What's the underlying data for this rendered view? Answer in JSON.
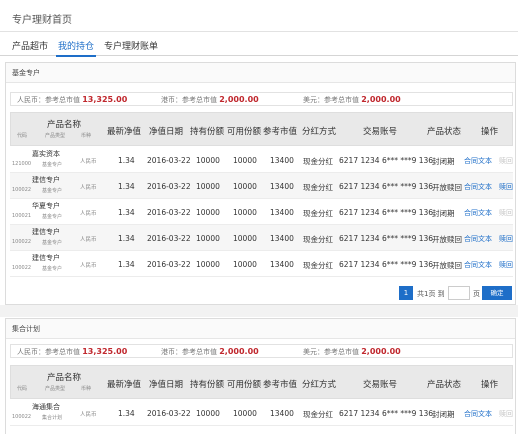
{
  "page": {
    "title": "专户理财首页"
  },
  "tabs": [
    {
      "label": "产品超市"
    },
    {
      "label": "我的持仓"
    },
    {
      "label": "专户理财账单"
    }
  ],
  "summary": {
    "rmb_label": "人民币：参考总市值",
    "hkd_label": "港币：参考总市值",
    "usd_label": "美元：参考总市值"
  },
  "table_header": {
    "product": "产品名称",
    "code": "代码",
    "type": "产品类型",
    "currency": "币种",
    "nav": "最新净值",
    "nav_date": "净值日期",
    "holding": "持有份额",
    "available": "可用份额",
    "market_value": "参考市值",
    "dividend": "分红方式",
    "account": "交易账号",
    "status": "产品状态",
    "action": "操作"
  },
  "sections": [
    {
      "title": "基金专户",
      "summary": {
        "rmb_value": "13,325.00",
        "hkd_value": "2,000.00",
        "usd_value": "2,000.00"
      },
      "rows": [
        {
          "name": "嘉实资本",
          "code": "121000",
          "type": "基金专户",
          "currency": "人民币",
          "nav": "1.34",
          "nav_date": "2016-03-22",
          "holding": "10000",
          "available": "10000",
          "market_value": "13400",
          "dividend": "现金分红",
          "account": "6217 1234 6*** ***9 136",
          "status": "封闭期",
          "contract": "合同文本",
          "redeem": "赎回",
          "redeem_enabled": false
        },
        {
          "name": "建信专户",
          "code": "100022",
          "type": "基金专户",
          "currency": "人民币",
          "nav": "1.34",
          "nav_date": "2016-03-22",
          "holding": "10000",
          "available": "10000",
          "market_value": "13400",
          "dividend": "现金分红",
          "account": "6217 1234 6*** ***9 136",
          "status": "开放赎回",
          "contract": "合同文本",
          "redeem": "赎回",
          "redeem_enabled": true
        },
        {
          "name": "华夏专户",
          "code": "100021",
          "type": "基金专户",
          "currency": "人民币",
          "nav": "1.34",
          "nav_date": "2016-03-22",
          "holding": "10000",
          "available": "10000",
          "market_value": "13400",
          "dividend": "现金分红",
          "account": "6217 1234 6*** ***9 136",
          "status": "封闭期",
          "contract": "合同文本",
          "redeem": "赎回",
          "redeem_enabled": false
        },
        {
          "name": "建信专户",
          "code": "100022",
          "type": "基金专户",
          "currency": "人民币",
          "nav": "1.34",
          "nav_date": "2016-03-22",
          "holding": "10000",
          "available": "10000",
          "market_value": "13400",
          "dividend": "现金分红",
          "account": "6217 1234 6*** ***9 136",
          "status": "开放赎回",
          "contract": "合同文本",
          "redeem": "赎回",
          "redeem_enabled": true
        },
        {
          "name": "建信专户",
          "code": "100022",
          "type": "基金专户",
          "currency": "人民币",
          "nav": "1.34",
          "nav_date": "2016-03-22",
          "holding": "10000",
          "available": "10000",
          "market_value": "13400",
          "dividend": "现金分红",
          "account": "6217 1234 6*** ***9 136",
          "status": "开放赎回",
          "contract": "合同文本",
          "redeem": "赎回",
          "redeem_enabled": true
        }
      ]
    },
    {
      "title": "集合计划",
      "summary": {
        "rmb_value": "13,325.00",
        "hkd_value": "2,000.00",
        "usd_value": "2,000.00"
      },
      "rows": [
        {
          "name": "海通集合",
          "code": "100022",
          "type": "集合计划",
          "currency": "人民币",
          "nav": "1.34",
          "nav_date": "2016-03-22",
          "holding": "10000",
          "available": "10000",
          "market_value": "13400",
          "dividend": "现金分红",
          "account": "6217 1234 6*** ***9 136",
          "status": "封闭期",
          "contract": "合同文本",
          "redeem": "赎回",
          "redeem_enabled": false
        }
      ]
    }
  ],
  "pager": {
    "current": "1",
    "total_text": "共1页 到",
    "page_suffix": "页",
    "confirm": "确定",
    "input_value": ""
  },
  "colors": {
    "accent": "#1e6ec8",
    "value_red": "#c0272d"
  }
}
